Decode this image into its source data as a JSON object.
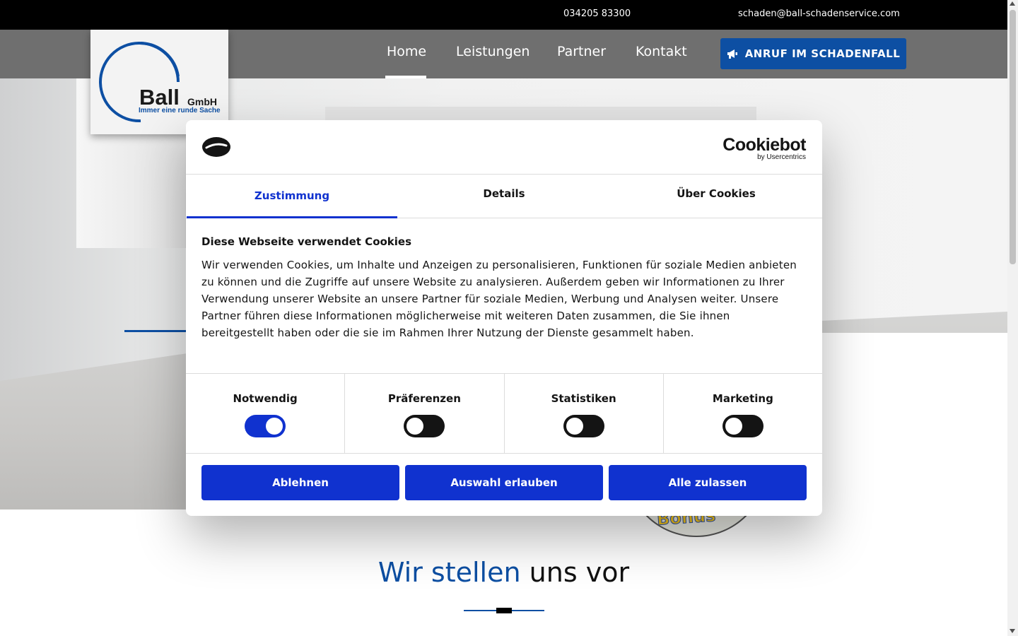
{
  "topbar": {
    "phone": "034205 83300",
    "email": "schaden@ball-schadenservice.com"
  },
  "logo": {
    "name": "Ball",
    "suffix": "GmbH",
    "slogan": "Immer eine runde Sache"
  },
  "nav": {
    "items": [
      {
        "label": "Home",
        "active": true
      },
      {
        "label": "Leistungen",
        "active": false
      },
      {
        "label": "Partner",
        "active": false
      },
      {
        "label": "Kontakt",
        "active": false
      }
    ],
    "cta_label": "ANRUF IM SCHADENFALL",
    "cta_icon": "megaphone-icon"
  },
  "section": {
    "title_accent": "Wir stellen",
    "title_rest": " uns vor"
  },
  "cookie_dialog": {
    "brand_name": "Cookiebot",
    "brand_sub": "by Usercentrics",
    "tabs": [
      {
        "label": "Zustimmung",
        "active": true
      },
      {
        "label": "Details",
        "active": false
      },
      {
        "label": "Über Cookies",
        "active": false
      }
    ],
    "heading": "Diese Webseite verwendet Cookies",
    "text": "Wir verwenden Cookies, um Inhalte und Anzeigen zu personalisieren, Funktionen für soziale Medien anbieten zu können und die Zugriffe auf unsere Website zu analysieren. Außerdem geben wir Informationen zu Ihrer Verwendung unserer Website an unsere Partner für soziale Medien, Werbung und Analysen weiter. Unsere Partner führen diese Informationen möglicherweise mit weiteren Daten zusammen, die Sie ihnen bereitgestellt haben oder die sie im Rahmen Ihrer Nutzung der Dienste gesammelt haben.",
    "consents": [
      {
        "label": "Notwendig",
        "enabled": true
      },
      {
        "label": "Präferenzen",
        "enabled": false
      },
      {
        "label": "Statistiken",
        "enabled": false
      },
      {
        "label": "Marketing",
        "enabled": false
      }
    ],
    "buttons": {
      "decline": "Ablehnen",
      "allow_selection": "Auswahl erlauben",
      "allow_all": "Alle zulassen"
    }
  },
  "colors": {
    "brand_blue": "#0d4fa3",
    "cookie_blue": "#1032cf",
    "nav_gray": "#6f6f6f"
  }
}
